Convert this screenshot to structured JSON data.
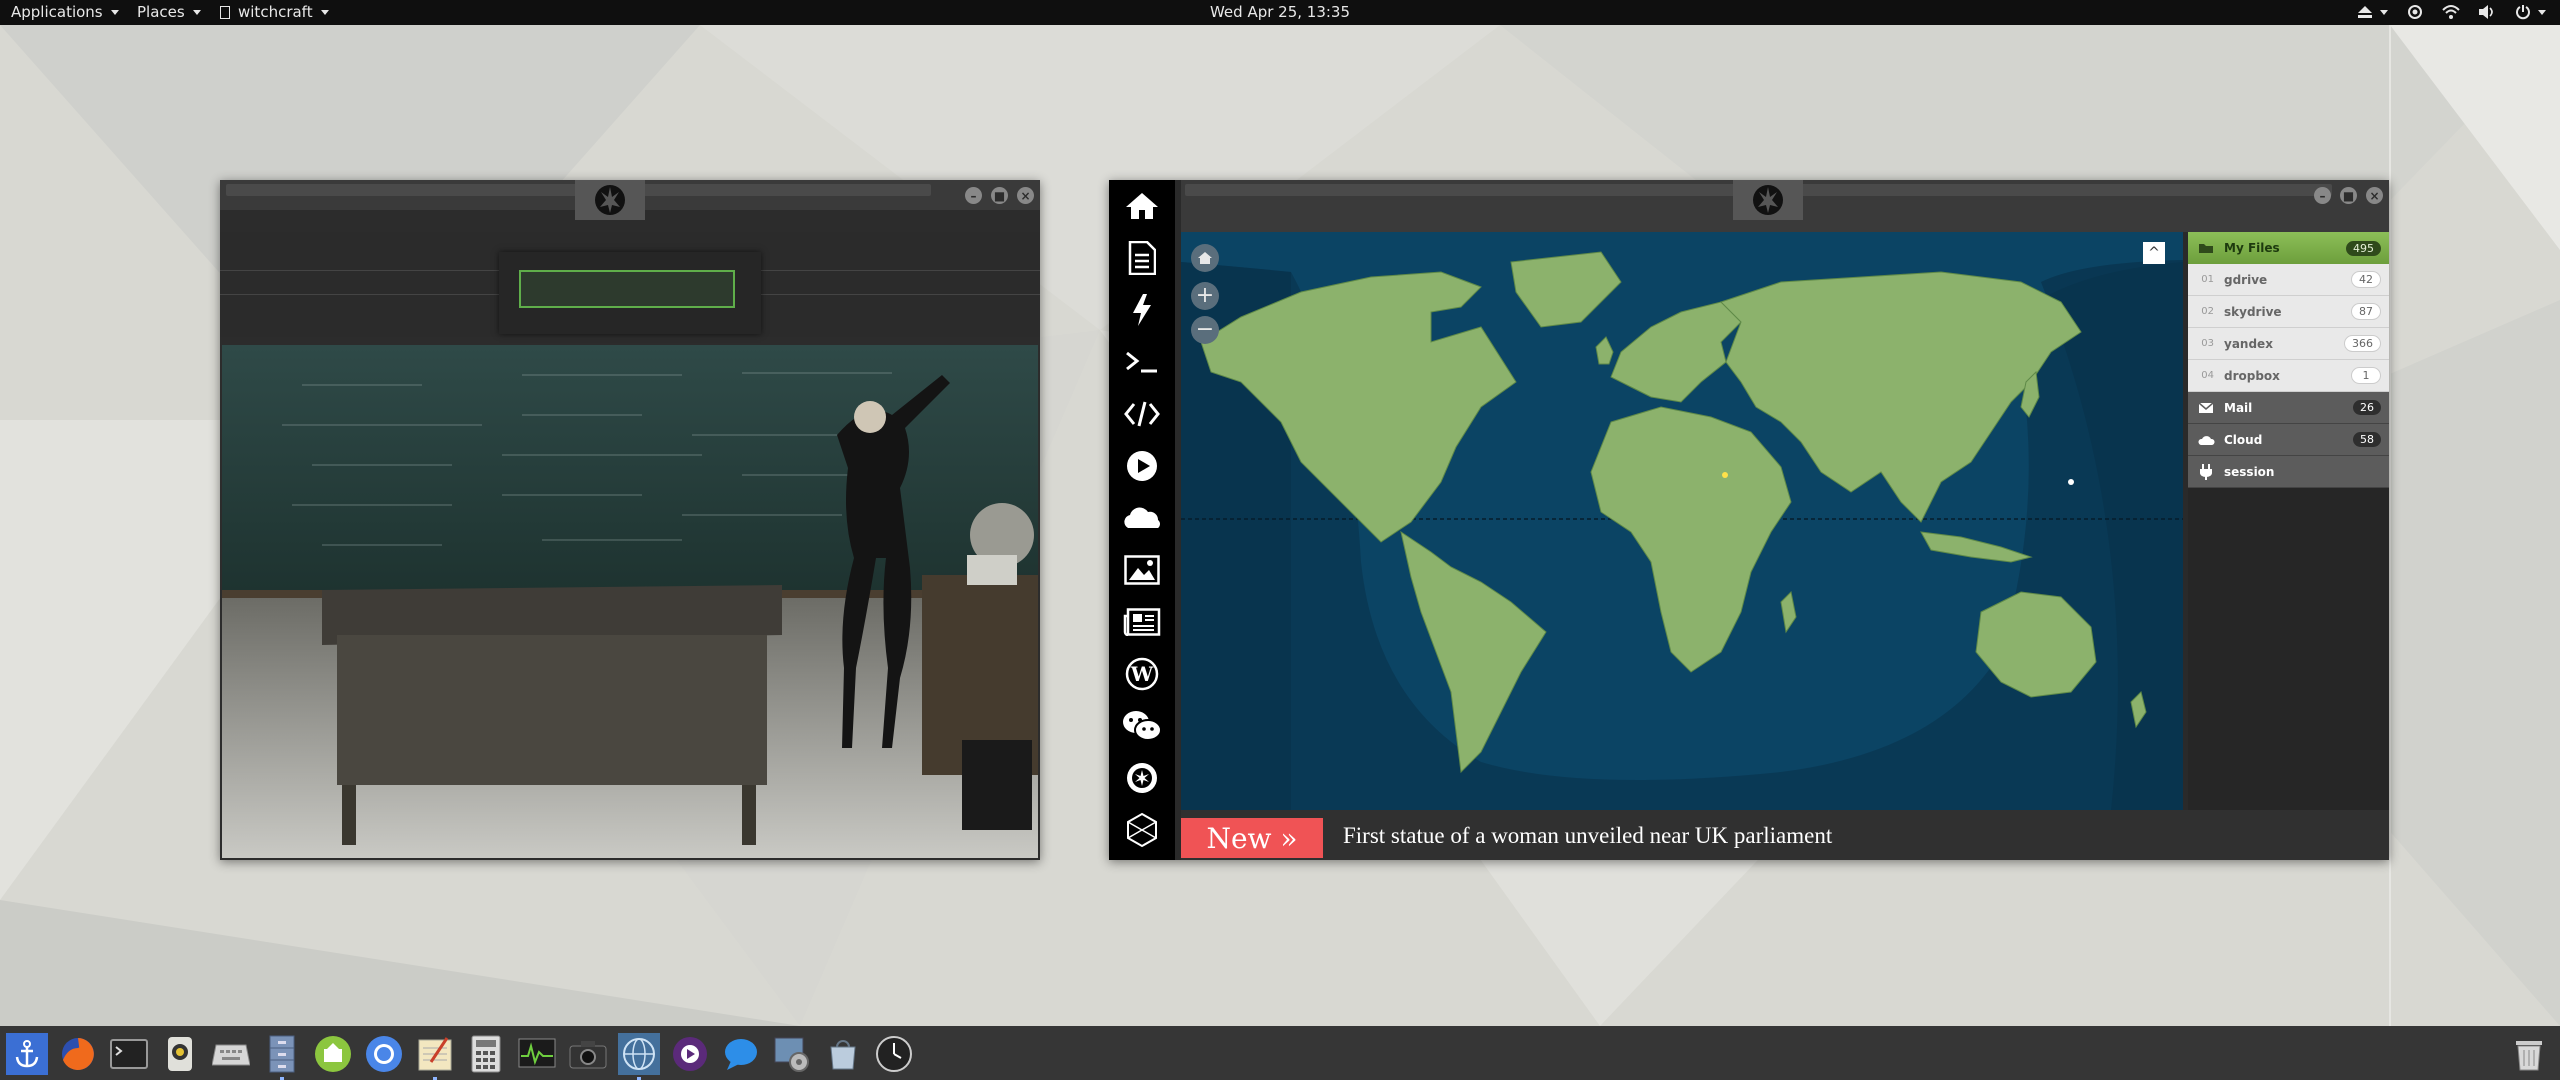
{
  "topbar": {
    "applications_label": "Applications",
    "places_label": "Places",
    "active_app_label": "witchcraft",
    "clock": "Wed Apr 25, 13:35",
    "tray_icons": [
      "eject-icon",
      "location-icon",
      "wifi-icon",
      "volume-icon",
      "power-icon"
    ]
  },
  "left_window": {
    "emblem": "rebel-alliance-icon",
    "password_input_value": "",
    "photo": "teacher-at-chalkboard-photo"
  },
  "right_window": {
    "emblem": "rebel-alliance-icon",
    "launcher_icons": [
      "home-icon",
      "document-icon",
      "lightning-icon",
      "terminal-icon",
      "code-icon",
      "play-icon",
      "cloud-icon",
      "image-icon",
      "news-icon",
      "wordpress-icon",
      "chat-icon",
      "settings-icon",
      "hexagon-icon"
    ],
    "map": {
      "home_button": "map-home-icon",
      "zoom_in": "+",
      "zoom_out": "−",
      "collapse": "^"
    },
    "files": {
      "my_files": {
        "label": "My Files",
        "count": "495"
      },
      "drives": [
        {
          "num": "01",
          "label": "gdrive",
          "count": "42"
        },
        {
          "num": "02",
          "label": "skydrive",
          "count": "87"
        },
        {
          "num": "03",
          "label": "yandex",
          "count": "366"
        },
        {
          "num": "04",
          "label": "dropbox",
          "count": "1"
        }
      ],
      "mail": {
        "label": "Mail",
        "count": "26"
      },
      "cloud": {
        "label": "Cloud",
        "count": "58"
      },
      "session": {
        "label": "session"
      }
    },
    "news": {
      "tag": "New »",
      "headline": "First statue of a woman unveiled near UK parliament"
    }
  },
  "dock": {
    "items": [
      "anchor-icon",
      "firefox-icon",
      "terminal-icon",
      "camera-app-icon",
      "keyboard-icon",
      "file-cabinet-icon",
      "drive-sync-icon",
      "chromium-icon",
      "text-editor-icon",
      "calculator-icon",
      "system-monitor-icon",
      "camera-icon",
      "globe-icon",
      "media-player-icon",
      "chat-bubble-icon",
      "settings-app-icon",
      "software-store-icon",
      "clock-icon"
    ],
    "trash": "trash-icon"
  }
}
